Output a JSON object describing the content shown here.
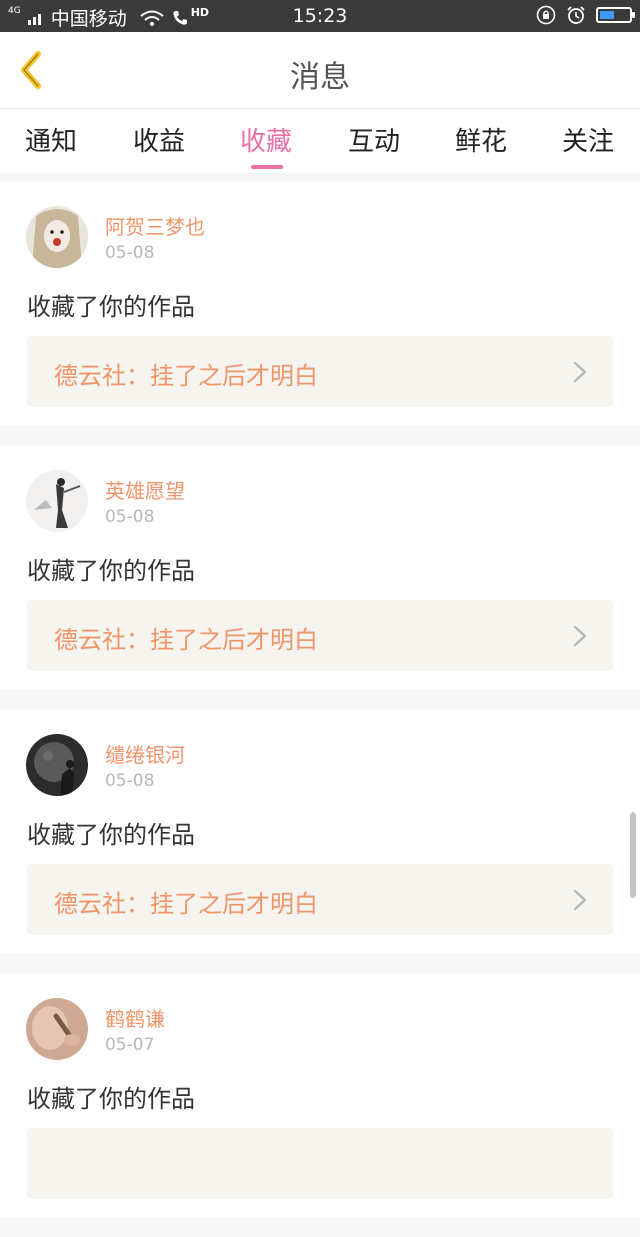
{
  "status_bar": {
    "network_badge": "4G",
    "carrier": "中国移动",
    "hd_label": "HD",
    "time": "15:23",
    "battery_level": 0.5,
    "battery_color": "#3b9cff"
  },
  "header": {
    "title": "消息",
    "back_icon": "chevron-left-icon",
    "back_icon_color": "#f4c325"
  },
  "tabs": [
    {
      "label": "通知",
      "active": false
    },
    {
      "label": "收益",
      "active": false
    },
    {
      "label": "收藏",
      "active": true
    },
    {
      "label": "互动",
      "active": false
    },
    {
      "label": "鲜花",
      "active": false
    },
    {
      "label": "关注",
      "active": false
    }
  ],
  "accent_color": "#ea6fa4",
  "name_color": "#f0956a",
  "items": [
    {
      "username": "阿贺三梦也",
      "date": "05-08",
      "action": "收藏了你的作品",
      "work_title": "德云社：挂了之后才明白"
    },
    {
      "username": "英雄愿望",
      "date": "05-08",
      "action": "收藏了你的作品",
      "work_title": "德云社：挂了之后才明白"
    },
    {
      "username": "缱绻银河",
      "date": "05-08",
      "action": "收藏了你的作品",
      "work_title": "德云社：挂了之后才明白"
    },
    {
      "username": "鹤鹤谦",
      "date": "05-07",
      "action": "收藏了你的作品",
      "work_title": ""
    }
  ]
}
